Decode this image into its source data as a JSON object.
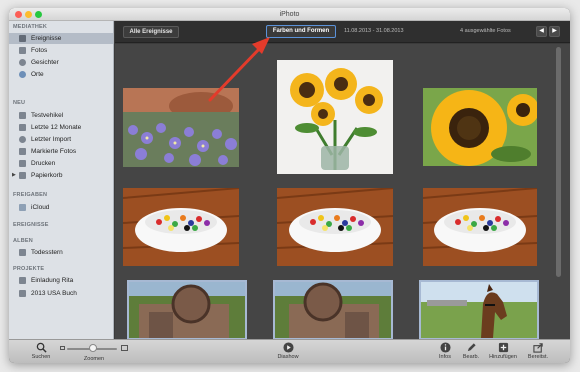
{
  "window": {
    "title": "iPhoto"
  },
  "sidebar": {
    "sections": [
      {
        "heading": "MEDIATHEK",
        "items": [
          {
            "label": "Ereignisse",
            "icon": "events-icon",
            "selected": true
          },
          {
            "label": "Fotos",
            "icon": "photos-icon"
          },
          {
            "label": "Gesichter",
            "icon": "faces-icon"
          },
          {
            "label": "Orte",
            "icon": "places-icon"
          }
        ]
      },
      {
        "heading": "NEU",
        "items": [
          {
            "label": "Testvehikel",
            "icon": "event-icon"
          },
          {
            "label": "Letzte 12 Monate",
            "icon": "calendar-icon"
          },
          {
            "label": "Letzter Import",
            "icon": "clock-icon"
          },
          {
            "label": "Markierte Fotos",
            "icon": "flag-icon"
          },
          {
            "label": "Drucken",
            "icon": "printer-icon"
          },
          {
            "label": "Papierkorb",
            "icon": "trash-icon"
          }
        ]
      },
      {
        "heading": "FREIGABEN",
        "items": [
          {
            "label": "iCloud",
            "icon": "icloud-icon"
          }
        ]
      },
      {
        "heading": "EREIGNISSE",
        "items": []
      },
      {
        "heading": "ALBEN",
        "items": [
          {
            "label": "Todesstern",
            "icon": "album-icon"
          }
        ]
      },
      {
        "heading": "PROJEKTE",
        "items": [
          {
            "label": "Einladung Rita",
            "icon": "card-icon"
          },
          {
            "label": "2013 USA Buch",
            "icon": "book-icon"
          }
        ]
      }
    ]
  },
  "topbar": {
    "all_events_label": "Alle Ereignisse",
    "search_tag": "Farben und Formen",
    "date_range": "11.08.2013 - 31.08.2013",
    "selected_count": "4 ausgewählte Fotos",
    "prev_icon": "◀",
    "next_icon": "▶"
  },
  "photos": [
    {
      "subject": "lavender-flowers-pot"
    },
    {
      "subject": "sunflowers-vase"
    },
    {
      "subject": "sunflower-closeup"
    },
    {
      "subject": "candy-bowl"
    },
    {
      "subject": "candy-bowl"
    },
    {
      "subject": "candy-bowl"
    },
    {
      "subject": "rusty-machine",
      "selected": true
    },
    {
      "subject": "rusty-machine",
      "selected": true
    },
    {
      "subject": "horse",
      "selected": true
    }
  ],
  "toolbar": {
    "search_label": "Suchen",
    "zoom_label": "Zoomen",
    "slideshow_label": "Diashow",
    "info_label": "Infos",
    "edit_label": "Bearb.",
    "add_label": "Hinzufügen",
    "share_label": "Bereitst."
  },
  "colors": {
    "accent": "#5b92d9",
    "annotation_arrow": "#e33b2b"
  }
}
